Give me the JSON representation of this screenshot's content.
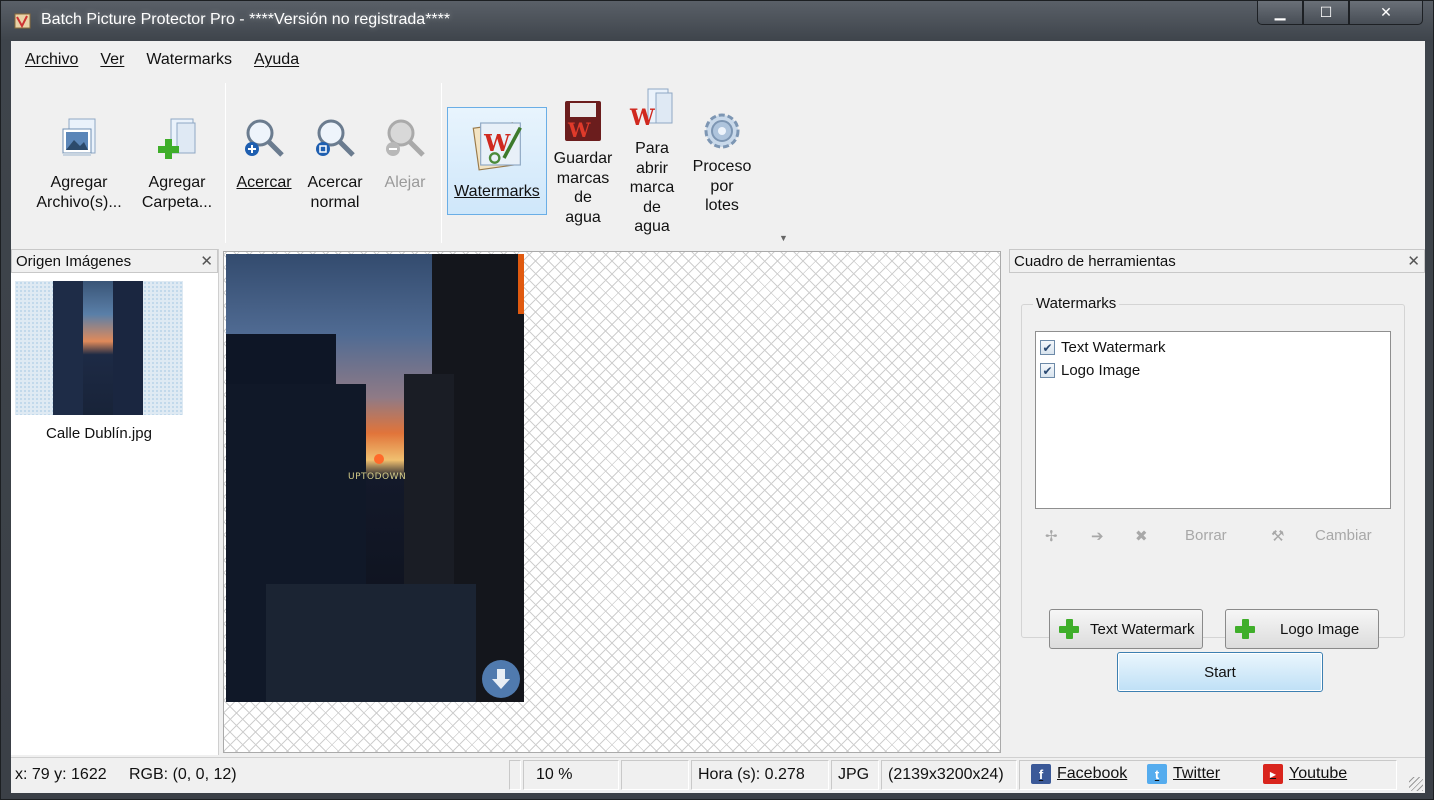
{
  "window": {
    "title": "Batch Picture Protector Pro - ****Versión no registrada****",
    "controls": {
      "minimize": "▁",
      "maximize": "☐",
      "close": "✕"
    }
  },
  "menu": [
    "Archivo",
    "Ver",
    "Watermarks",
    "Ayuda"
  ],
  "toolbar": {
    "add_files": "Agregar\nArchivo(s)...",
    "add_folder": "Agregar\nCarpeta...",
    "zoom_in": "Acercar",
    "zoom_normal": "Acercar\nnormal",
    "zoom_out": "Alejar",
    "watermarks": "Watermarks",
    "save_watermarks": "Guardar\nmarcas\nde\nagua",
    "open_watermark": "Para\nabrir\nmarca\nde\nagua",
    "batch_process": "Proceso\npor\nlotes"
  },
  "left_panel": {
    "title": "Origen Imágenes",
    "close": "✕",
    "thumbnail_label": "Calle Dublín.jpg"
  },
  "preview": {
    "watermark_text": "UPTODOWN"
  },
  "right_panel": {
    "title": "Cuadro de herramientas",
    "close": "✕",
    "group_title": "Watermarks",
    "items": [
      {
        "label": "Text Watermark",
        "checked": true
      },
      {
        "label": "Logo Image",
        "checked": true
      }
    ],
    "tools": {
      "delete": "Borrar",
      "change": "Cambiar"
    },
    "add_text_button": "Text Watermark",
    "add_logo_button": "Logo Image",
    "start_button": "Start"
  },
  "statusbar": {
    "coords": "x: 79 y: 1622",
    "rgb": "RGB: (0, 0, 12)",
    "zoom": "10 %",
    "time": "Hora (s): 0.278",
    "format": "JPG",
    "dimensions": "(2139x3200x24)",
    "facebook": "Facebook",
    "twitter": "Twitter",
    "youtube": "Youtube"
  },
  "colors": {
    "accent_selected": "#cfe7fa",
    "plus_green": "#3fae2a",
    "facebook": "#3b5998",
    "twitter": "#55acee",
    "youtube": "#d9251d"
  },
  "icons": {
    "add_files": "picture-add-icon",
    "add_folder": "folder-add-icon",
    "zoom_in": "zoom-in-icon",
    "zoom_normal": "zoom-normal-icon",
    "zoom_out": "zoom-out-icon",
    "watermarks": "watermark-W-icon",
    "save": "save-watermark-icon",
    "open": "open-watermark-icon",
    "batch": "gear-icon"
  }
}
